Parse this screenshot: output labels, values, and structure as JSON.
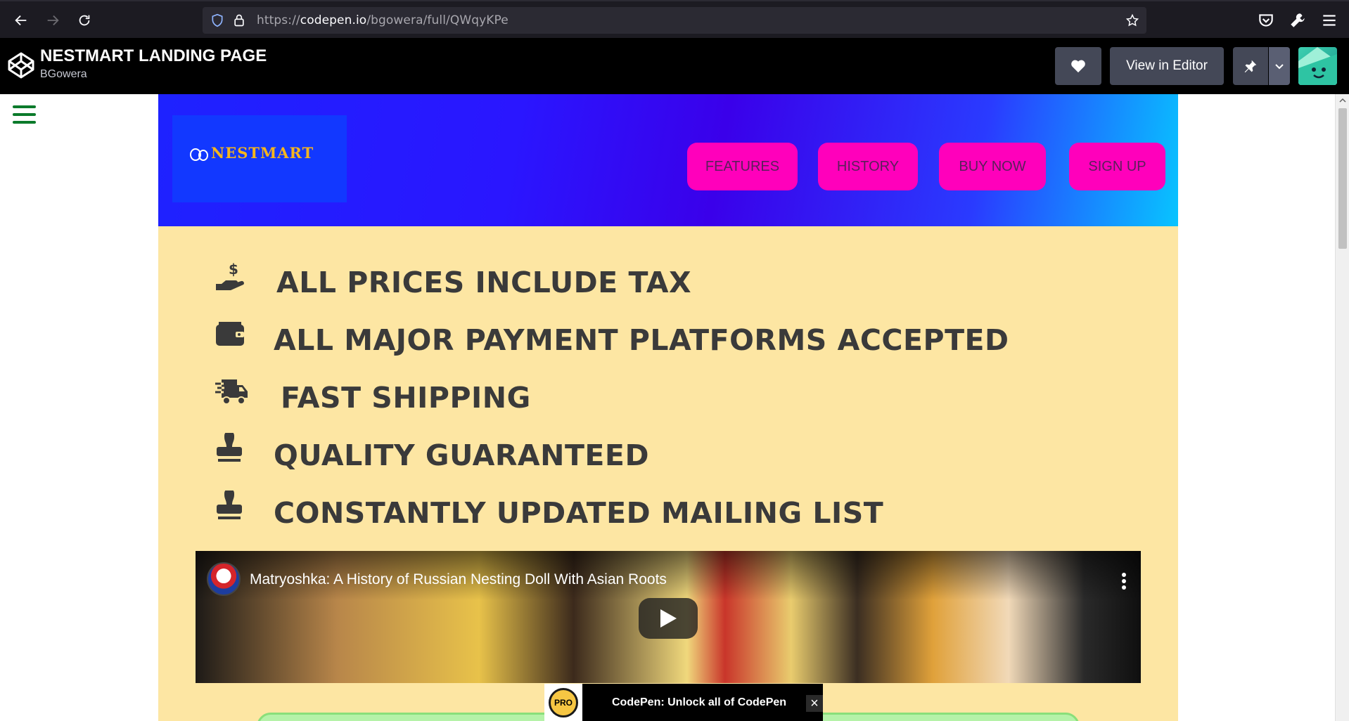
{
  "browser": {
    "url_prefix": "https://",
    "url_host": "codepen.io",
    "url_path": "/bgowera/full/QWqyKPe"
  },
  "codepen": {
    "title": "NESTMART LANDING PAGE",
    "author": "BGowera",
    "view_in_editor_label": "View in Editor"
  },
  "page": {
    "logo_text": "NESTMART",
    "nav": [
      "FEATURES",
      "HISTORY",
      "BUY NOW",
      "SIGN UP"
    ],
    "features": [
      {
        "icon": "hand-dollar-icon",
        "text": "ALL PRICES INCLUDE TAX"
      },
      {
        "icon": "wallet-icon",
        "text": "ALL MAJOR PAYMENT PLATFORMS ACCEPTED"
      },
      {
        "icon": "truck-fast-icon",
        "text": "FAST SHIPPING"
      },
      {
        "icon": "stamp-icon",
        "text": "QUALITY GUARANTEED"
      },
      {
        "icon": "stamp-icon",
        "text": "CONSTANTLY UPDATED MAILING LIST"
      }
    ],
    "video": {
      "title": "Matryoshka: A History of Russian Nesting Doll With Asian Roots"
    }
  },
  "promo": {
    "badge": "PRO",
    "text": "CodePen: Unlock all of CodePen"
  },
  "colors": {
    "hamburger": "#0b7a2b",
    "nav_pill": "#ff00bb",
    "main_bg": "#fde6a3",
    "hero_start": "#1e22ff",
    "hero_end": "#08c4ff"
  }
}
